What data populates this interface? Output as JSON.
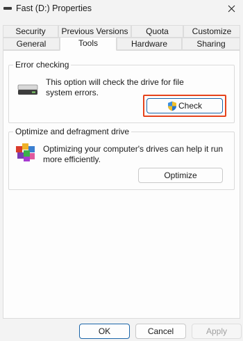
{
  "window": {
    "title": "Fast (D:) Properties",
    "close_icon": "close-icon"
  },
  "tabs": {
    "row1": [
      "Security",
      "Previous Versions",
      "Quota",
      "Customize"
    ],
    "row2": [
      "General",
      "Tools",
      "Hardware",
      "Sharing"
    ],
    "active": "Tools"
  },
  "error_checking": {
    "title": "Error checking",
    "description_line1": "This option will check the drive for file",
    "description_line2": "system errors.",
    "button_label": "Check",
    "button_icon": "uac-shield-icon",
    "drive_icon": "hard-drive-icon"
  },
  "optimize": {
    "title": "Optimize and defragment drive",
    "description_line1": "Optimizing your computer's drives can help it run",
    "description_line2": "more efficiently.",
    "button_label": "Optimize",
    "icon": "defrag-icon"
  },
  "footer": {
    "ok_label": "OK",
    "cancel_label": "Cancel",
    "apply_label": "Apply"
  },
  "colors": {
    "highlight": "#e6431c",
    "accent": "#1a64a8"
  }
}
